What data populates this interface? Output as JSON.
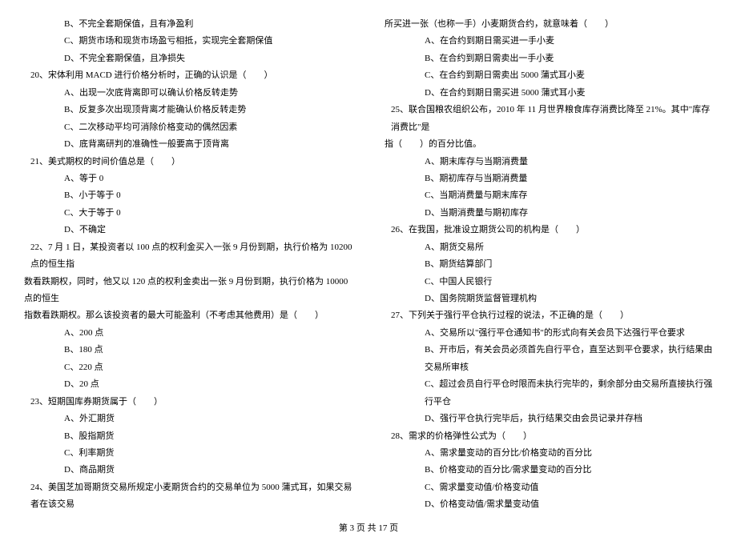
{
  "left": {
    "q19_b": "B、不完全套期保值，且有净盈利",
    "q19_c": "C、期货市场和现货市场盈亏相抵，实现完全套期保值",
    "q19_d": "D、不完全套期保值，且净损失",
    "q20": "20、宋体利用 MACD 进行价格分析时，正确的认识是（　　）",
    "q20_a": "A、出现一次底背离即可以确认价格反转走势",
    "q20_b": "B、反复多次出现顶背离才能确认价格反转走势",
    "q20_c": "C、二次移动平均可消除价格变动的偶然因素",
    "q20_d": "D、底背离研判的准确性一般要高于顶背离",
    "q21": "21、美式期权的时间价值总是（　　）",
    "q21_a": "A、等于 0",
    "q21_b": "B、小于等于 0",
    "q21_c": "C、大于等于 0",
    "q21_d": "D、不确定",
    "q22_l1": "22、7 月 1 日，某投资者以 100 点的权利金买入一张 9 月份到期，执行价格为 10200 点的恒生指",
    "q22_l2": "数看跌期权，同时，他又以 120 点的权利金卖出一张 9 月份到期，执行价格为 10000 点的恒生",
    "q22_l3": "指数看跌期权。那么该投资者的最大可能盈利（不考虑其他费用）是（　　）",
    "q22_a": "A、200 点",
    "q22_b": "B、180 点",
    "q22_c": "C、220 点",
    "q22_d": "D、20 点",
    "q23": "23、短期国库券期货属于（　　）",
    "q23_a": "A、外汇期货",
    "q23_b": "B、股指期货",
    "q23_c": "C、利率期货",
    "q23_d": "D、商品期货",
    "q24": "24、美国芝加哥期货交易所规定小麦期货合约的交易单位为 5000 蒲式耳，如果交易者在该交易"
  },
  "right": {
    "q24_l2": "所买进一张（也称一手）小麦期货合约，就意味着（　　）",
    "q24_a": "A、在合约到期日需买进一手小麦",
    "q24_b": "B、在合约到期日需卖出一手小麦",
    "q24_c": "C、在合约到期日需卖出 5000 蒲式耳小麦",
    "q24_d": "D、在合约到期日需买进 5000 蒲式耳小麦",
    "q25_l1": "25、联合国粮农组织公布，2010 年 11 月世界粮食库存消费比降至 21%。其中\"库存消费比\"是",
    "q25_l2": "指（　　）的百分比值。",
    "q25_a": "A、期末库存与当期消费量",
    "q25_b": "B、期初库存与当期消费量",
    "q25_c": "C、当期消费量与期末库存",
    "q25_d": "D、当期消费量与期初库存",
    "q26": "26、在我国，批准设立期货公司的机构是（　　）",
    "q26_a": "A、期货交易所",
    "q26_b": "B、期货结算部门",
    "q26_c": "C、中国人民银行",
    "q26_d": "D、国务院期货监督管理机构",
    "q27": "27、下列关于强行平仓执行过程的说法，不正确的是（　　）",
    "q27_a": "A、交易所以\"强行平仓通知书\"的形式向有关会员下达强行平仓要求",
    "q27_b": "B、开市后，有关会员必须首先自行平仓，直至达到平仓要求，执行结果由交易所审核",
    "q27_c": "C、超过会员自行平仓时限而未执行完毕的，剩余部分由交易所直接执行强行平仓",
    "q27_d": "D、强行平仓执行完毕后，执行结果交由会员记录并存档",
    "q28": "28、需求的价格弹性公式为（　　）",
    "q28_a": "A、需求量变动的百分比/价格变动的百分比",
    "q28_b": "B、价格变动的百分比/需求量变动的百分比",
    "q28_c": "C、需求量变动值/价格变动值",
    "q28_d": "D、价格变动值/需求量变动值"
  },
  "footer": "第 3 页 共 17 页"
}
